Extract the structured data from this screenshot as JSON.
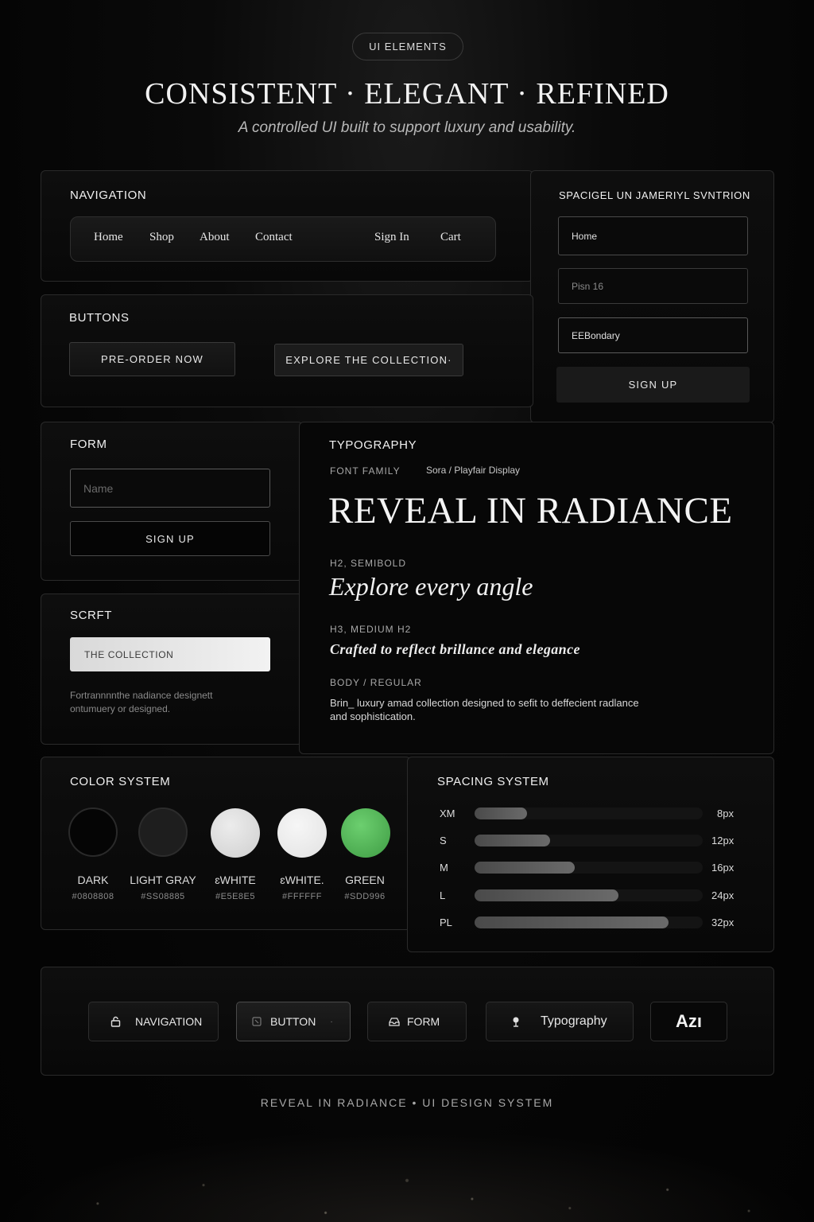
{
  "header": {
    "pill": "UI ELEMENTS",
    "headline": "CONSISTENT  ·  ELEGANT  · REFINED",
    "subhead": "A controlled UI built to support luxury and usability."
  },
  "navigation": {
    "title": "NAVIGATION",
    "links": [
      "Home",
      "Shop",
      "About",
      "Contact",
      "Sign In",
      "Cart"
    ]
  },
  "signup_panel": {
    "title": "SPACIGEL UN JAMERIYL SVNTRION",
    "fields": [
      "Home",
      "Pisn 16",
      "EEBondary"
    ],
    "button": "SIGN UP"
  },
  "buttons": {
    "title": "BUTTONS",
    "primary": "PRE-ORDER NOW",
    "secondary": "EXPLORE THE COLLECTION·"
  },
  "form": {
    "title": "FORM",
    "name_placeholder": "Name",
    "button": "SIGN UP"
  },
  "scrft": {
    "title": "SCRFT",
    "button": "THE COLLECTION",
    "text_line1": "Fortrannnnthe nadiance designett",
    "text_line2": "ontumuery or designed."
  },
  "typography": {
    "title": "TYPOGRAPHY",
    "font_family_label": "FONT FAMILY",
    "font_family_value": "Sora / Playfair Display",
    "h1": "REVEAL IN RADIANCE",
    "h2_label": "H2, SEMIBOLD",
    "h2": "Explore every angle",
    "h3_label": "H3, MEDIUM H2",
    "h3": "Crafted to reflect brillance and elegance",
    "body_label": "BODY / REGULAR",
    "body_line1": "Brin_ luxury amad collection designed to sefit to deffecient radlance",
    "body_line2": "and sophistication."
  },
  "color_system": {
    "title": "COLOR SYSTEM",
    "swatches": [
      {
        "name": "DARK",
        "hex": "#0808808",
        "color": "#050505"
      },
      {
        "name": "LIGHT GRAY",
        "hex": "#SS08885",
        "color": "#1e1e1e"
      },
      {
        "name": "ɛWHITE",
        "hex": "#E5E8E5",
        "color": "#d9d9d9"
      },
      {
        "name": "ɛWHITE.",
        "hex": "#FFFFFF",
        "color": "#ededed"
      },
      {
        "name": "GREEN",
        "hex": "#SDD996",
        "color": "#4caf50"
      }
    ]
  },
  "spacing_system": {
    "title": "SPACING SYSTEM",
    "rows": [
      {
        "label": "XM",
        "value": "8px",
        "fill": 0.23
      },
      {
        "label": "S",
        "value": "12px",
        "fill": 0.33
      },
      {
        "label": "M",
        "value": "16px",
        "fill": 0.44
      },
      {
        "label": "L",
        "value": "24px",
        "fill": 0.63
      },
      {
        "label": "PL",
        "value": "32px",
        "fill": 0.85
      }
    ]
  },
  "bottom_bar": {
    "chips": [
      {
        "label": "NAVIGATION",
        "icon": "lock-icon"
      },
      {
        "label": "BUTTON",
        "icon": "cursor-icon"
      },
      {
        "label": "FORM",
        "icon": "tray-icon"
      },
      {
        "label": "Typography",
        "icon": "pin-icon"
      },
      {
        "label": "Azı"
      }
    ]
  },
  "footer": "REVEAL IN RADIANCE  •  UI DESIGN SYSTEM"
}
